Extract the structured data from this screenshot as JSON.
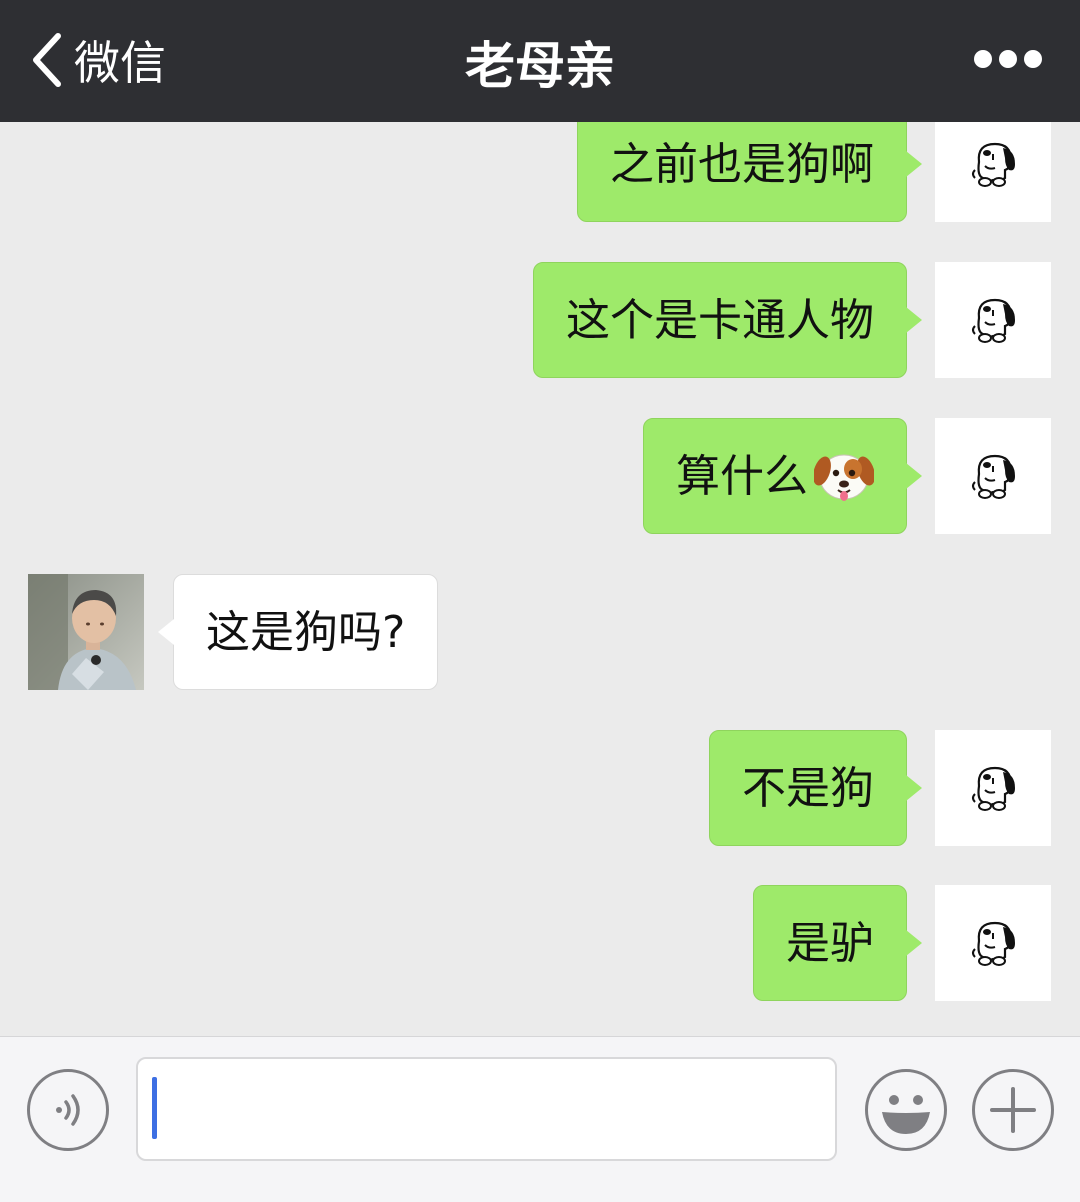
{
  "navbar": {
    "back_label": "微信",
    "title": "老母亲",
    "more_icon": "more-dots-icon"
  },
  "messages": [
    {
      "sender": "me",
      "text": "之前也是狗啊",
      "avatar_icon": "snoopy-avatar-icon"
    },
    {
      "sender": "me",
      "text": "这个是卡通人物",
      "avatar_icon": "snoopy-avatar-icon"
    },
    {
      "sender": "me",
      "text": "算什么",
      "emoji": "dog-face-emoji",
      "avatar_icon": "snoopy-avatar-icon"
    },
    {
      "sender": "other",
      "text": "这是狗吗?",
      "avatar_icon": "boy-photo-avatar"
    },
    {
      "sender": "me",
      "text": "不是狗",
      "avatar_icon": "snoopy-avatar-icon"
    },
    {
      "sender": "me",
      "text": "是驴",
      "avatar_icon": "snoopy-avatar-icon"
    }
  ],
  "input_bar": {
    "value": "",
    "icons": [
      "voice-icon",
      "smiley-icon",
      "plus-icon"
    ]
  },
  "colors": {
    "navbar_bg": "#2e2f33",
    "chat_bg": "#ebebeb",
    "my_bubble": "#9eea6a",
    "their_bubble": "#ffffff",
    "caret": "#3d6fe3"
  }
}
